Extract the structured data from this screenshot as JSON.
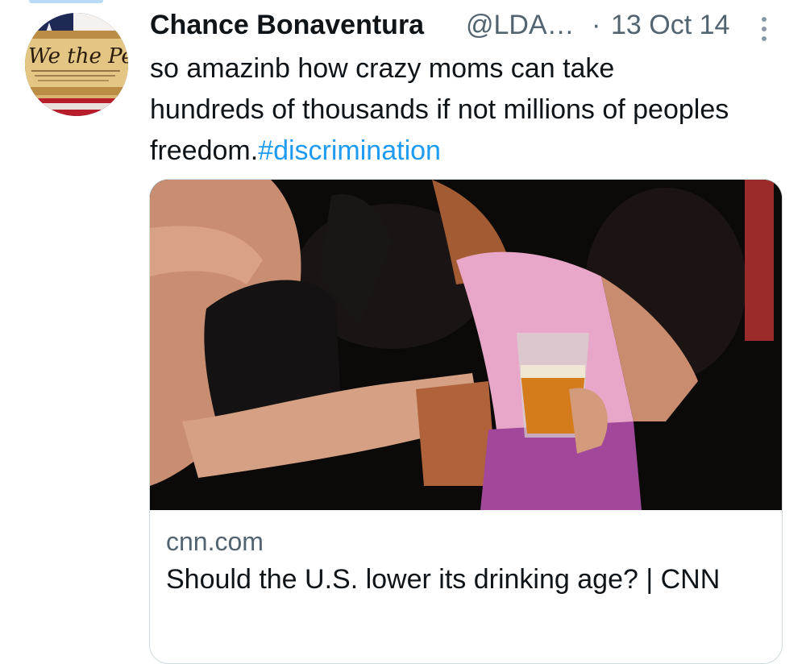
{
  "tweet": {
    "author_name": "Chance Bonaventura",
    "handle": "@LDA…",
    "separator": "·",
    "date": "13 Oct 14",
    "text": "so amazinb how crazy moms can take hundreds of thousands if not millions of peoples freedom.",
    "hashtag": "#discrimination",
    "avatar_icon": "constitution-flag-avatar",
    "more_icon": "vertical-dots-icon"
  },
  "card": {
    "domain": "cnn.com",
    "title": "Should the U.S. lower its drinking age? | CNN",
    "image_description_icon": "party-photo-image"
  },
  "colors": {
    "text": "#0f1419",
    "secondary": "#536471",
    "link": "#1d9bf0",
    "border": "#cfd9de"
  }
}
